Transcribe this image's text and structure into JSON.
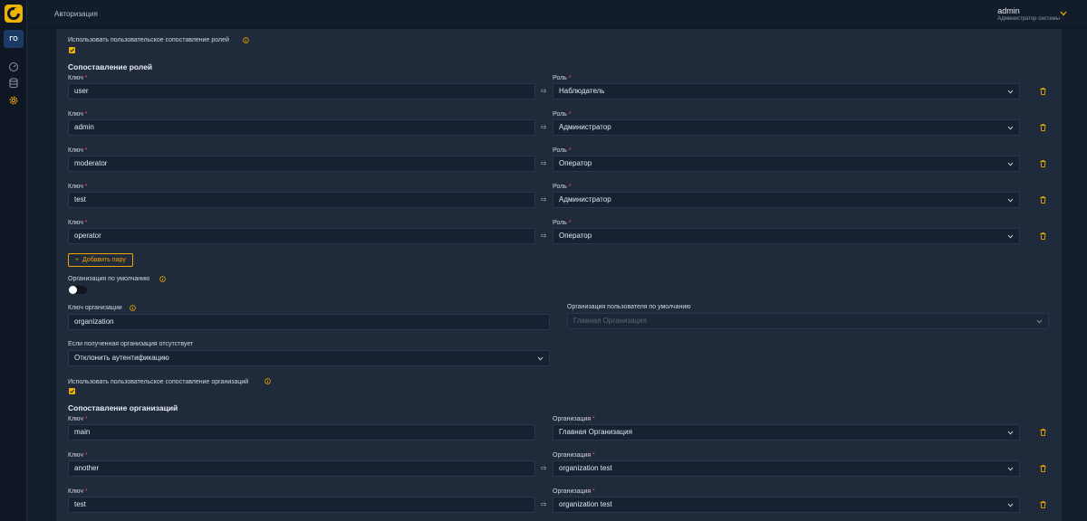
{
  "header": {
    "breadcrumb": "Авторизация",
    "user_name": "admin",
    "user_role": "Администратор системы"
  },
  "sidebar": {
    "org_badge": "ГО",
    "items": [
      {
        "icon": "dashboard-icon"
      },
      {
        "icon": "database-icon"
      },
      {
        "icon": "gear-icon",
        "active": true
      }
    ]
  },
  "role_mapping": {
    "use_custom_label": "Использовать пользовательское сопоставление ролей",
    "use_custom_checked": true,
    "section_title": "Сопоставление ролей",
    "key_label": "Ключ",
    "role_label": "Роль",
    "rows": [
      {
        "key": "user",
        "role": "Наблюдатель"
      },
      {
        "key": "admin",
        "role": "Администратор"
      },
      {
        "key": "moderator",
        "role": "Оператор"
      },
      {
        "key": "test",
        "role": "Администратор"
      },
      {
        "key": "operator",
        "role": "Оператор"
      }
    ],
    "add_pair_label": "Добавить пару"
  },
  "organization": {
    "default_org_label": "Организация по умолчанию",
    "default_org_enabled": false,
    "org_key_label": "Ключ организации",
    "org_key_value": "organization",
    "user_default_org_label": "Организация пользователя по умолчанию",
    "user_default_org_value": "Главная Организация",
    "missing_org_label": "Если полученная организация отсутствует",
    "missing_org_value": "Отклонить аутентификацию"
  },
  "org_mapping": {
    "use_custom_label": "Использовать пользовательское сопоставление организаций",
    "use_custom_checked": true,
    "section_title": "Сопоставление организаций",
    "key_label": "Ключ",
    "org_label": "Организация",
    "rows": [
      {
        "key": "main",
        "org": "Главная Организация"
      },
      {
        "key": "another",
        "org": "organization test"
      },
      {
        "key": "test",
        "org": "organization test"
      }
    ]
  },
  "colors": {
    "accent": "#f0a500",
    "required": "#e0533d",
    "panel": "#1f2a3b",
    "background": "#131d2b"
  }
}
